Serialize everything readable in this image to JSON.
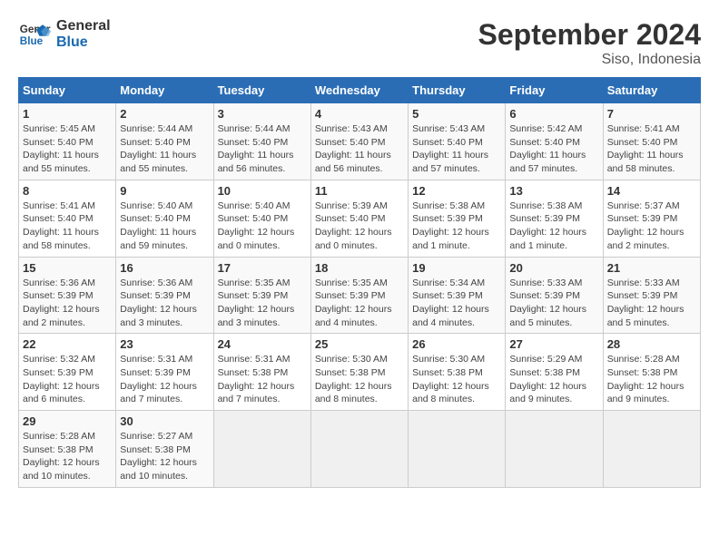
{
  "logo": {
    "line1": "General",
    "line2": "Blue"
  },
  "title": "September 2024",
  "subtitle": "Siso, Indonesia",
  "days_of_week": [
    "Sunday",
    "Monday",
    "Tuesday",
    "Wednesday",
    "Thursday",
    "Friday",
    "Saturday"
  ],
  "weeks": [
    [
      {
        "day": "1",
        "detail": "Sunrise: 5:45 AM\nSunset: 5:40 PM\nDaylight: 11 hours and 55 minutes."
      },
      {
        "day": "2",
        "detail": "Sunrise: 5:44 AM\nSunset: 5:40 PM\nDaylight: 11 hours and 55 minutes."
      },
      {
        "day": "3",
        "detail": "Sunrise: 5:44 AM\nSunset: 5:40 PM\nDaylight: 11 hours and 56 minutes."
      },
      {
        "day": "4",
        "detail": "Sunrise: 5:43 AM\nSunset: 5:40 PM\nDaylight: 11 hours and 56 minutes."
      },
      {
        "day": "5",
        "detail": "Sunrise: 5:43 AM\nSunset: 5:40 PM\nDaylight: 11 hours and 57 minutes."
      },
      {
        "day": "6",
        "detail": "Sunrise: 5:42 AM\nSunset: 5:40 PM\nDaylight: 11 hours and 57 minutes."
      },
      {
        "day": "7",
        "detail": "Sunrise: 5:41 AM\nSunset: 5:40 PM\nDaylight: 11 hours and 58 minutes."
      }
    ],
    [
      {
        "day": "8",
        "detail": "Sunrise: 5:41 AM\nSunset: 5:40 PM\nDaylight: 11 hours and 58 minutes."
      },
      {
        "day": "9",
        "detail": "Sunrise: 5:40 AM\nSunset: 5:40 PM\nDaylight: 11 hours and 59 minutes."
      },
      {
        "day": "10",
        "detail": "Sunrise: 5:40 AM\nSunset: 5:40 PM\nDaylight: 12 hours and 0 minutes."
      },
      {
        "day": "11",
        "detail": "Sunrise: 5:39 AM\nSunset: 5:40 PM\nDaylight: 12 hours and 0 minutes."
      },
      {
        "day": "12",
        "detail": "Sunrise: 5:38 AM\nSunset: 5:39 PM\nDaylight: 12 hours and 1 minute."
      },
      {
        "day": "13",
        "detail": "Sunrise: 5:38 AM\nSunset: 5:39 PM\nDaylight: 12 hours and 1 minute."
      },
      {
        "day": "14",
        "detail": "Sunrise: 5:37 AM\nSunset: 5:39 PM\nDaylight: 12 hours and 2 minutes."
      }
    ],
    [
      {
        "day": "15",
        "detail": "Sunrise: 5:36 AM\nSunset: 5:39 PM\nDaylight: 12 hours and 2 minutes."
      },
      {
        "day": "16",
        "detail": "Sunrise: 5:36 AM\nSunset: 5:39 PM\nDaylight: 12 hours and 3 minutes."
      },
      {
        "day": "17",
        "detail": "Sunrise: 5:35 AM\nSunset: 5:39 PM\nDaylight: 12 hours and 3 minutes."
      },
      {
        "day": "18",
        "detail": "Sunrise: 5:35 AM\nSunset: 5:39 PM\nDaylight: 12 hours and 4 minutes."
      },
      {
        "day": "19",
        "detail": "Sunrise: 5:34 AM\nSunset: 5:39 PM\nDaylight: 12 hours and 4 minutes."
      },
      {
        "day": "20",
        "detail": "Sunrise: 5:33 AM\nSunset: 5:39 PM\nDaylight: 12 hours and 5 minutes."
      },
      {
        "day": "21",
        "detail": "Sunrise: 5:33 AM\nSunset: 5:39 PM\nDaylight: 12 hours and 5 minutes."
      }
    ],
    [
      {
        "day": "22",
        "detail": "Sunrise: 5:32 AM\nSunset: 5:39 PM\nDaylight: 12 hours and 6 minutes."
      },
      {
        "day": "23",
        "detail": "Sunrise: 5:31 AM\nSunset: 5:39 PM\nDaylight: 12 hours and 7 minutes."
      },
      {
        "day": "24",
        "detail": "Sunrise: 5:31 AM\nSunset: 5:38 PM\nDaylight: 12 hours and 7 minutes."
      },
      {
        "day": "25",
        "detail": "Sunrise: 5:30 AM\nSunset: 5:38 PM\nDaylight: 12 hours and 8 minutes."
      },
      {
        "day": "26",
        "detail": "Sunrise: 5:30 AM\nSunset: 5:38 PM\nDaylight: 12 hours and 8 minutes."
      },
      {
        "day": "27",
        "detail": "Sunrise: 5:29 AM\nSunset: 5:38 PM\nDaylight: 12 hours and 9 minutes."
      },
      {
        "day": "28",
        "detail": "Sunrise: 5:28 AM\nSunset: 5:38 PM\nDaylight: 12 hours and 9 minutes."
      }
    ],
    [
      {
        "day": "29",
        "detail": "Sunrise: 5:28 AM\nSunset: 5:38 PM\nDaylight: 12 hours and 10 minutes."
      },
      {
        "day": "30",
        "detail": "Sunrise: 5:27 AM\nSunset: 5:38 PM\nDaylight: 12 hours and 10 minutes."
      },
      {
        "day": "",
        "detail": ""
      },
      {
        "day": "",
        "detail": ""
      },
      {
        "day": "",
        "detail": ""
      },
      {
        "day": "",
        "detail": ""
      },
      {
        "day": "",
        "detail": ""
      }
    ]
  ]
}
